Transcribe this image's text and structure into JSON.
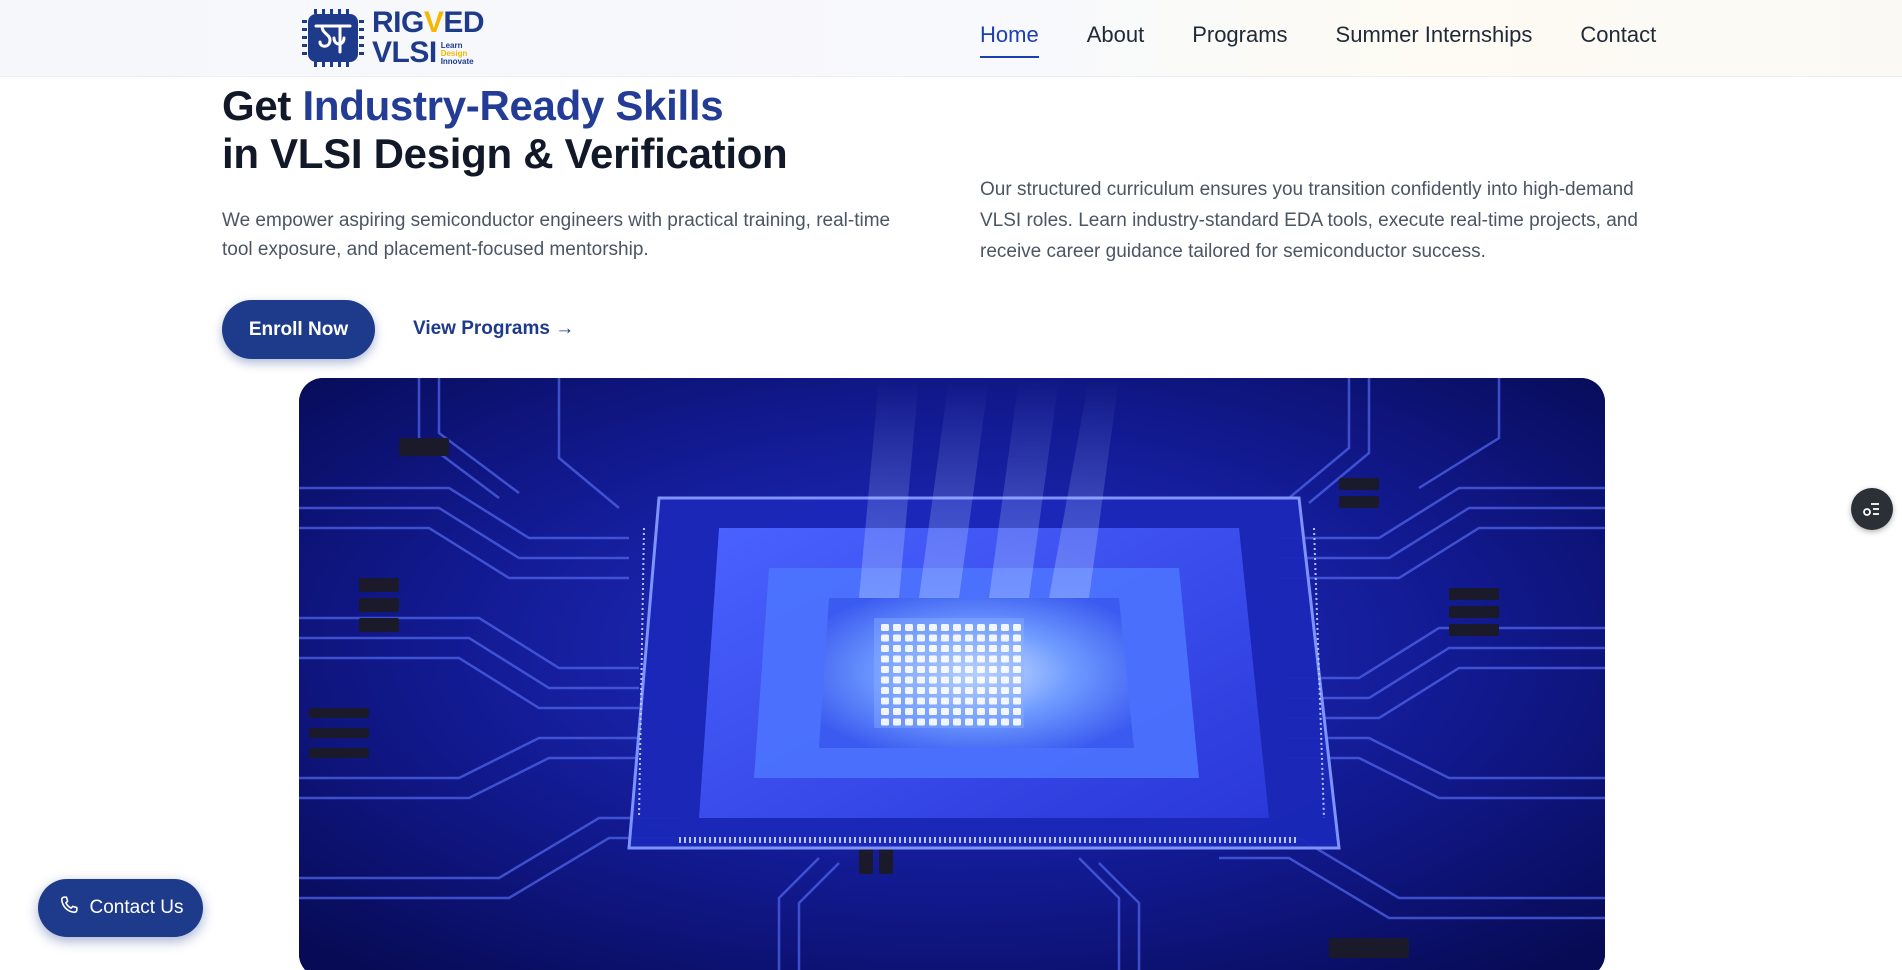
{
  "brand": {
    "logo_text_top_a": "RIG",
    "logo_text_top_b": "V",
    "logo_text_top_c": "ED",
    "logo_text_bottom": "VLSI",
    "tagline": [
      "Learn",
      "Design",
      "Innovate"
    ]
  },
  "nav": {
    "items": [
      {
        "label": "Home",
        "active": true
      },
      {
        "label": "About",
        "active": false
      },
      {
        "label": "Programs",
        "active": false
      },
      {
        "label": "Summer Internships",
        "active": false
      },
      {
        "label": "Contact",
        "active": false
      }
    ]
  },
  "hero": {
    "title_prefix": "Get ",
    "title_highlight": "Industry-Ready Skills",
    "title_line2": "in VLSI Design & Verification",
    "subtitle": "We empower aspiring semiconductor engineers with practical training, real-time tool exposure, and placement-focused mentorship.",
    "description": "Our structured curriculum ensures you transition confidently into high-demand VLSI roles. Learn industry-standard EDA tools, execute real-time projects, and receive career guidance tailored for semiconductor success.",
    "enroll_label": "Enroll Now",
    "programs_link": "View Programs →"
  },
  "widgets": {
    "contact_label": "Contact Us",
    "menu_icon": "list-settings-icon",
    "phone_icon": "phone-icon"
  },
  "colors": {
    "primary": "#1e3a8a",
    "highlight": "#233c95",
    "accent": "#f5b800",
    "circuit": "#0a0f6e"
  }
}
